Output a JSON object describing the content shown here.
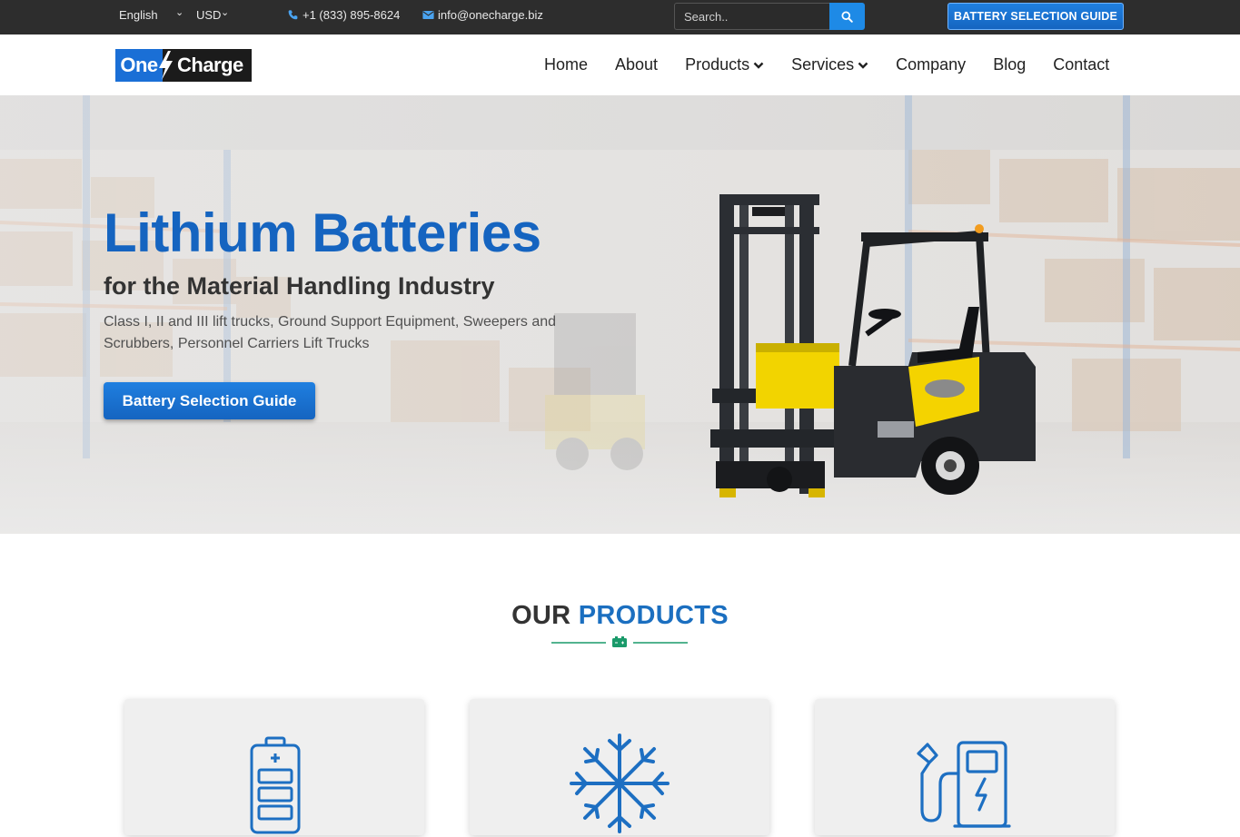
{
  "topbar": {
    "language": "English",
    "currency": "USD",
    "phone": "+1 (833) 895-8624",
    "email": "info@onecharge.biz",
    "search_placeholder": "Search..",
    "guide_button": "BATTERY SELECTION GUIDE"
  },
  "logo": {
    "part1": "One",
    "part2": "Charge"
  },
  "nav": {
    "home": "Home",
    "about": "About",
    "products": "Products",
    "services": "Services",
    "company": "Company",
    "blog": "Blog",
    "contact": "Contact"
  },
  "hero": {
    "title": "Lithium Batteries",
    "subtitle": "for the Material Handling Industry",
    "description": "Class I, II and III lift trucks, Ground Support Equipment, Sweepers and Scrubbers, Personnel Carriers Lift Trucks",
    "button": "Battery Selection Guide"
  },
  "products": {
    "heading_word1": "OUR",
    "heading_word2": "PRODUCTS",
    "cards": [
      {
        "icon": "battery-icon"
      },
      {
        "icon": "snowflake-icon"
      },
      {
        "icon": "charging-station-icon"
      }
    ]
  },
  "colors": {
    "brand_blue": "#1564c0",
    "topbar": "#2d2d2d",
    "accent_green": "#1a9a6a"
  }
}
